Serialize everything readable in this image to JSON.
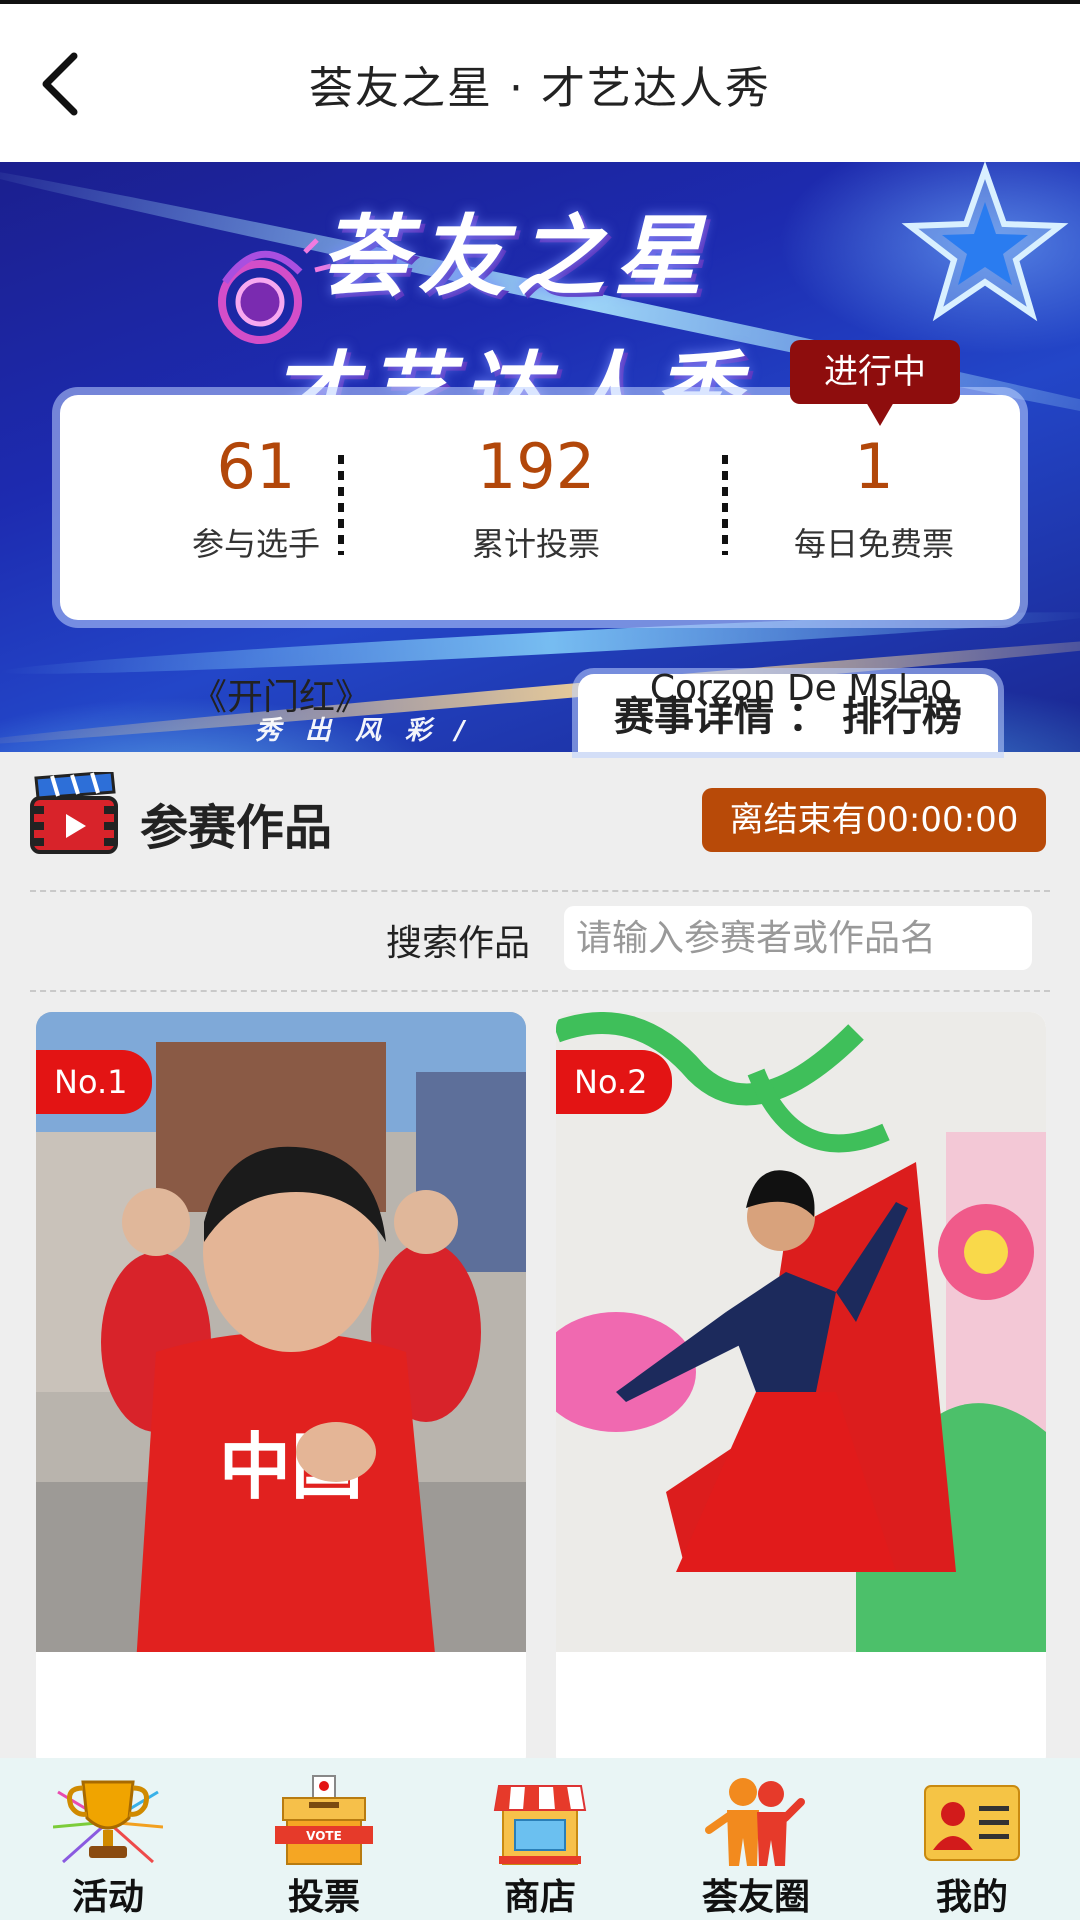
{
  "header": {
    "title": "荟友之星 · 才艺达人秀"
  },
  "banner": {
    "title_line1": "荟友之星",
    "title_line2": "才艺达人秀",
    "tagline": "秀出风彩/"
  },
  "stats": {
    "participants": {
      "value": "61",
      "label": "参与选手"
    },
    "total_votes": {
      "value": "192",
      "label": "累计投票"
    },
    "daily_free": {
      "value": "1",
      "label": "每日免费票"
    },
    "status": "进行中"
  },
  "tabs": {
    "details": "赛事详情",
    "separator": "：",
    "ranking": "排行榜"
  },
  "section": {
    "title": "参赛作品",
    "countdown": "离结束有00:00:00"
  },
  "search": {
    "label": "搜索作品",
    "placeholder": "请输入参赛者或作品名"
  },
  "entries": [
    {
      "rank": "No.1",
      "title": "《开门红》"
    },
    {
      "rank": "No.2",
      "title": "Corzon De Mslao"
    }
  ],
  "nav": {
    "items": [
      {
        "label": "活动",
        "icon": "trophy-icon"
      },
      {
        "label": "投票",
        "icon": "ballot-box-icon"
      },
      {
        "label": "商店",
        "icon": "store-icon"
      },
      {
        "label": "荟友圈",
        "icon": "friends-icon"
      },
      {
        "label": "我的",
        "icon": "profile-card-icon"
      }
    ]
  },
  "colors": {
    "accent_orange": "#b84a08",
    "stat_value": "#b2470a",
    "status_red": "#8e0d0d",
    "rank_red": "#e31414",
    "nav_bg": "#e9f5f5"
  }
}
